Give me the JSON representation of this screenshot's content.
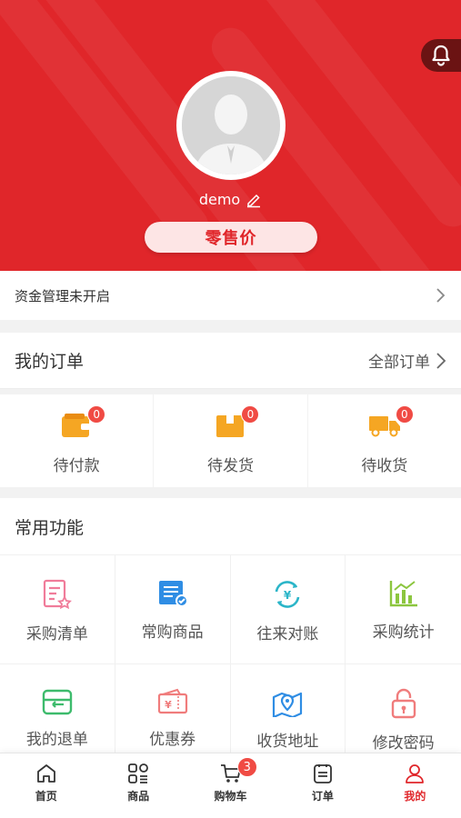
{
  "colors": {
    "primary": "#e0262a",
    "badge": "#f04b44"
  },
  "profile": {
    "username": "demo",
    "price_label": "零售价",
    "edit_icon": "pencil-icon",
    "bell_icon": "bell-icon"
  },
  "fund": {
    "label": "资金管理未开启"
  },
  "orders": {
    "title": "我的订单",
    "all_label": "全部订单",
    "statuses": [
      {
        "label": "待付款",
        "count": "0",
        "icon": "wallet-icon"
      },
      {
        "label": "待发货",
        "count": "0",
        "icon": "package-icon"
      },
      {
        "label": "待收货",
        "count": "0",
        "icon": "truck-icon"
      }
    ]
  },
  "tools": {
    "title": "常用功能",
    "items": [
      {
        "label": "采购清单",
        "icon": "purchase-list-icon"
      },
      {
        "label": "常购商品",
        "icon": "frequent-goods-icon"
      },
      {
        "label": "往来对账",
        "icon": "reconcile-icon"
      },
      {
        "label": "采购统计",
        "icon": "statistics-icon"
      },
      {
        "label": "我的退单",
        "icon": "return-order-icon"
      },
      {
        "label": "优惠券",
        "icon": "coupon-icon"
      },
      {
        "label": "收货地址",
        "icon": "address-icon"
      },
      {
        "label": "修改密码",
        "icon": "password-lock-icon"
      }
    ]
  },
  "tabbar": {
    "items": [
      {
        "label": "首页",
        "icon": "home-icon"
      },
      {
        "label": "商品",
        "icon": "goods-grid-icon"
      },
      {
        "label": "购物车",
        "icon": "cart-icon",
        "badge": "3"
      },
      {
        "label": "订单",
        "icon": "order-list-icon"
      },
      {
        "label": "我的",
        "icon": "user-icon",
        "active": true
      }
    ]
  }
}
